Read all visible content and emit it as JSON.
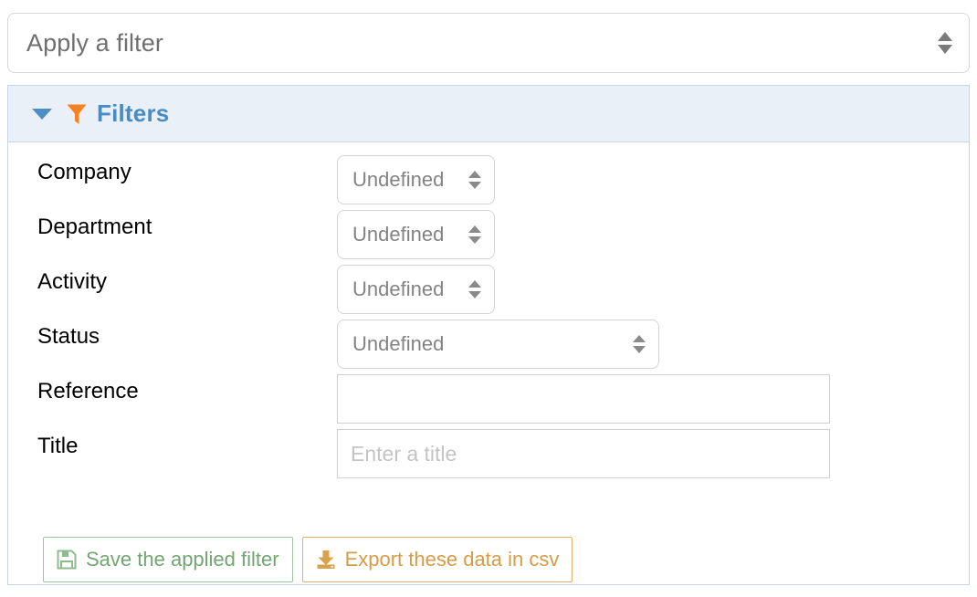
{
  "apply_filter": {
    "name": "apply-a-filter-select",
    "selected_value": "Apply a filter",
    "arrows_icon": "updown-arrows-icon"
  },
  "filters_panel": {
    "header": {
      "title": "Filters",
      "caret_icon": "caret-down-icon",
      "funnel_icon": "funnel-icon",
      "title_color": "#4a8cc2",
      "background_color": "#eaf0f8"
    },
    "rows": [
      {
        "label": "Company",
        "control": "select",
        "value": "Undefined",
        "width": "narrow"
      },
      {
        "label": "Department",
        "control": "select",
        "value": "Undefined",
        "width": "narrow"
      },
      {
        "label": "Activity",
        "control": "select",
        "value": "Undefined",
        "width": "narrow"
      },
      {
        "label": "Status",
        "control": "select",
        "value": "Undefined",
        "width": "wide"
      },
      {
        "label": "Reference",
        "control": "text",
        "value": "",
        "placeholder": ""
      },
      {
        "label": "Title",
        "control": "text",
        "value": "",
        "placeholder": "Enter a title"
      }
    ],
    "actions": {
      "save": {
        "label": "Save the applied filter",
        "icon": "floppy-disk-save-icon",
        "color": "#72a572",
        "border_color": "#9fc49f"
      },
      "export": {
        "label": "Export these data in csv",
        "icon": "download-tray-icon",
        "color": "#d69c46",
        "border_color": "#e0b070"
      }
    }
  }
}
